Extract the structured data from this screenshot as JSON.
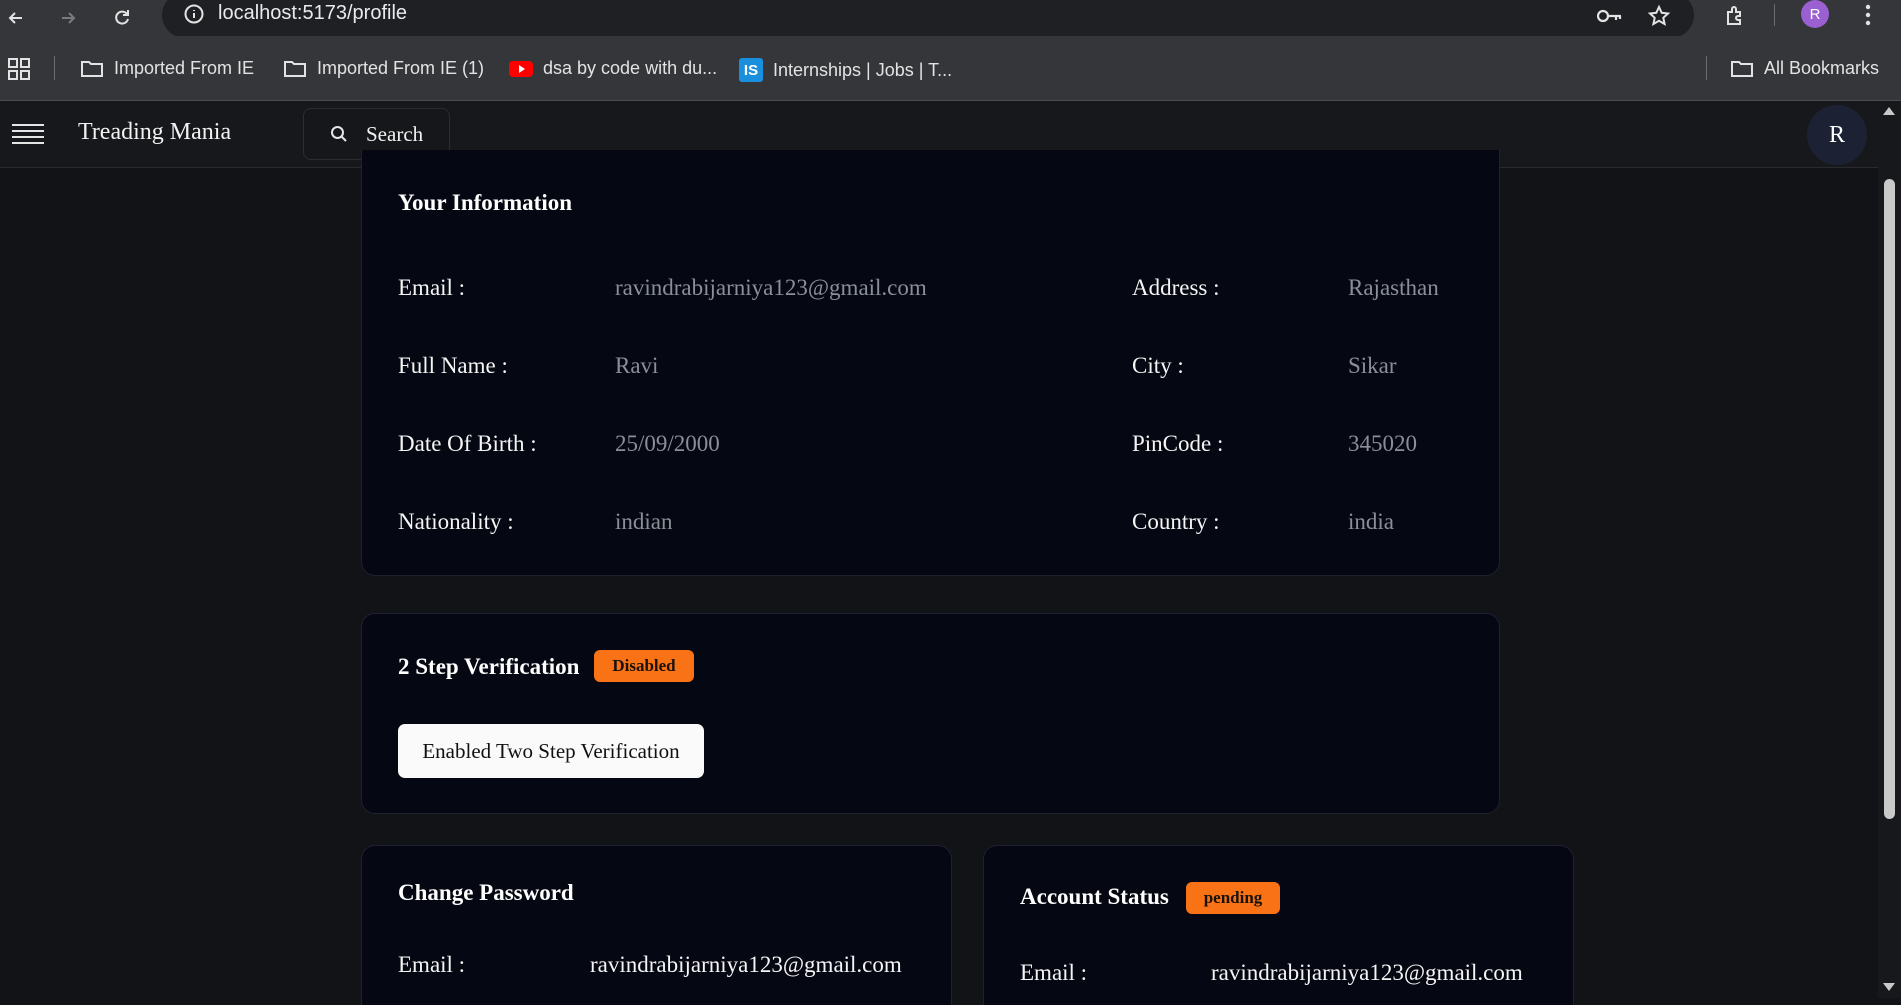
{
  "browser": {
    "url": "localhost:5173/profile",
    "profile_initial": "R",
    "bookmarks": [
      {
        "label": "Imported From IE"
      },
      {
        "label": "Imported From IE (1)"
      },
      {
        "label": "dsa by code with du..."
      },
      {
        "label": "Internships | Jobs | T..."
      }
    ],
    "all_bookmarks": "All Bookmarks",
    "is_icon_text": "IS"
  },
  "navbar": {
    "brand": "Treading Mania",
    "search_label": "Search",
    "avatar_initial": "R"
  },
  "info": {
    "title": "Your Information",
    "left": [
      {
        "label": "Email :",
        "value": "ravindrabijarniya123@gmail.com"
      },
      {
        "label": "Full Name :",
        "value": "Ravi"
      },
      {
        "label": "Date Of Birth :",
        "value": "25/09/2000"
      },
      {
        "label": "Nationality :",
        "value": "indian"
      }
    ],
    "right": [
      {
        "label": "Address :",
        "value": "Rajasthan"
      },
      {
        "label": "City :",
        "value": "Sikar"
      },
      {
        "label": "PinCode :",
        "value": "345020"
      },
      {
        "label": "Country :",
        "value": "india"
      }
    ]
  },
  "two_step": {
    "title": "2 Step Verification",
    "badge": "Disabled",
    "button": "Enabled Two Step Verification"
  },
  "change_password": {
    "title": "Change Password",
    "email_label": "Email :",
    "email_value": "ravindrabijarniya123@gmail.com"
  },
  "account_status": {
    "title": "Account Status",
    "badge": "pending",
    "email_label": "Email :",
    "email_value": "ravindrabijarniya123@gmail.com"
  },
  "colors": {
    "badge": "#f97316",
    "card_bg": "#050812",
    "page_bg": "#121317"
  }
}
